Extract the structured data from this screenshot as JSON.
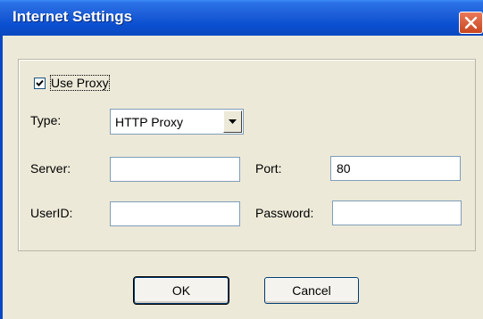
{
  "window": {
    "title": "Internet Settings"
  },
  "proxy": {
    "use_proxy_label": "Use Proxy",
    "use_proxy_checked": true,
    "type_label": "Type:",
    "type_value": "HTTP Proxy",
    "server_label": "Server:",
    "server_value": "",
    "port_label": "Port:",
    "port_value": "80",
    "userid_label": "UserID:",
    "userid_value": "",
    "password_label": "Password:",
    "password_value": ""
  },
  "buttons": {
    "ok_label": "OK",
    "cancel_label": "Cancel"
  },
  "icons": {
    "close": "close-icon",
    "check": "checkmark-icon",
    "dropdown": "chevron-down-icon"
  },
  "colors": {
    "titlebar": "#0a4fd0",
    "close_button": "#d8573a",
    "dialog_bg": "#ece9d8"
  }
}
